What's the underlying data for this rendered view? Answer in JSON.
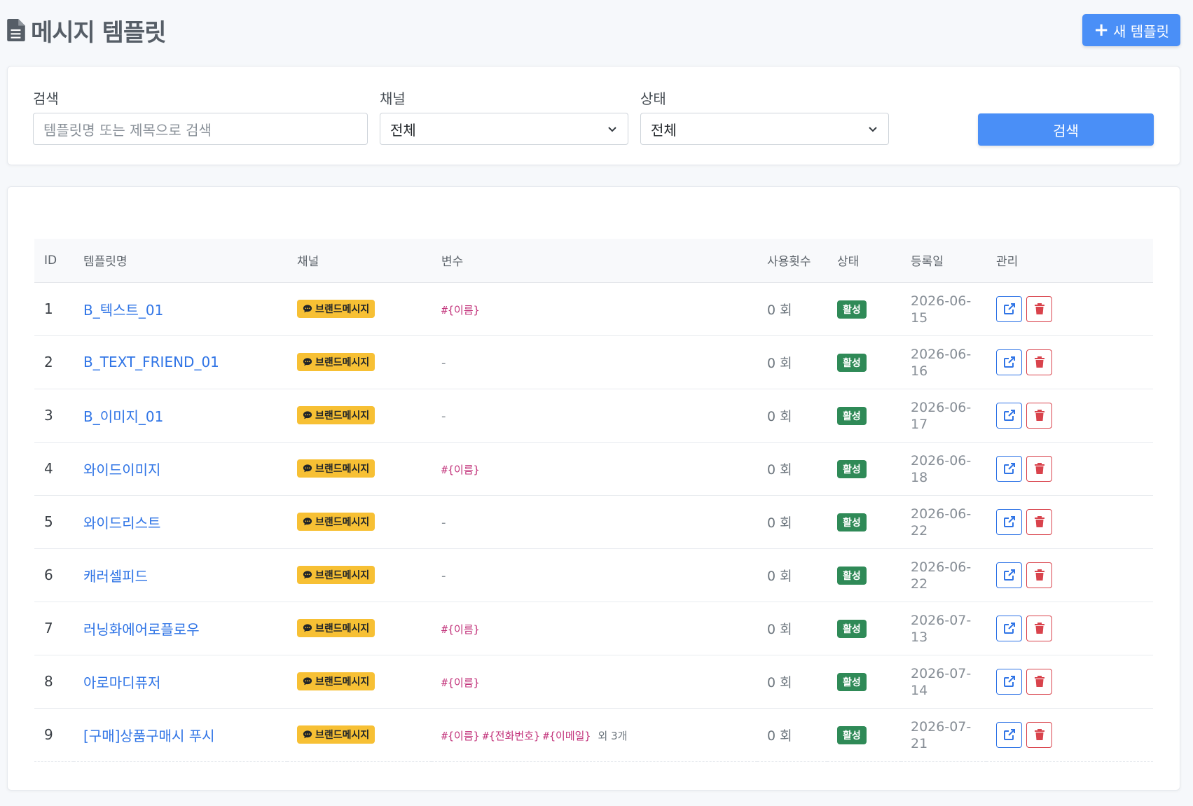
{
  "header": {
    "title": "메시지 템플릿",
    "new_button": "새 템플릿"
  },
  "search": {
    "search_label": "검색",
    "search_placeholder": "템플릿명 또는 제목으로 검색",
    "channel_label": "채널",
    "channel_value": "전체",
    "status_label": "상태",
    "status_value": "전체",
    "search_button": "검색"
  },
  "table": {
    "columns": [
      "ID",
      "템플릿명",
      "채널",
      "변수",
      "사용횟수",
      "상태",
      "등록일",
      "관리"
    ],
    "rows": [
      {
        "id": "1",
        "name": "B_텍스트_01",
        "channel": "브랜드메시지",
        "vars": [
          "#{이름}"
        ],
        "more": "",
        "usage": "0 회",
        "status": "활성",
        "date": "2026-06-15"
      },
      {
        "id": "2",
        "name": "B_TEXT_FRIEND_01",
        "channel": "브랜드메시지",
        "vars": [],
        "more": "",
        "usage": "0 회",
        "status": "활성",
        "date": "2026-06-16"
      },
      {
        "id": "3",
        "name": "B_이미지_01",
        "channel": "브랜드메시지",
        "vars": [],
        "more": "",
        "usage": "0 회",
        "status": "활성",
        "date": "2026-06-17"
      },
      {
        "id": "4",
        "name": "와이드이미지",
        "channel": "브랜드메시지",
        "vars": [
          "#{이름}"
        ],
        "more": "",
        "usage": "0 회",
        "status": "활성",
        "date": "2026-06-18"
      },
      {
        "id": "5",
        "name": "와이드리스트",
        "channel": "브랜드메시지",
        "vars": [],
        "more": "",
        "usage": "0 회",
        "status": "활성",
        "date": "2026-06-22"
      },
      {
        "id": "6",
        "name": "캐러셀피드",
        "channel": "브랜드메시지",
        "vars": [],
        "more": "",
        "usage": "0 회",
        "status": "활성",
        "date": "2026-06-22"
      },
      {
        "id": "7",
        "name": "러닝화에어로플로우",
        "channel": "브랜드메시지",
        "vars": [
          "#{이름}"
        ],
        "more": "",
        "usage": "0 회",
        "status": "활성",
        "date": "2026-07-13"
      },
      {
        "id": "8",
        "name": "아로마디퓨저",
        "channel": "브랜드메시지",
        "vars": [
          "#{이름}"
        ],
        "more": "",
        "usage": "0 회",
        "status": "활성",
        "date": "2026-07-14"
      },
      {
        "id": "9",
        "name": "[구매]상품구매시 푸시",
        "channel": "브랜드메시지",
        "vars": [
          "#{이름}",
          "#{전화번호}",
          "#{이메일}"
        ],
        "more": "외 3개",
        "usage": "0 회",
        "status": "활성",
        "date": "2026-07-21"
      }
    ],
    "empty_vars": "-"
  },
  "colors": {
    "primary": "#4a8ff7",
    "link": "#2f74e6",
    "channel_badge": "#f7c034",
    "status_badge": "#2f8a57",
    "variable": "#c2327a",
    "delete": "#d9434c"
  },
  "icons": {
    "title": "file-text-icon",
    "new": "plus-icon",
    "dropdown": "chevron-down-icon",
    "channel": "chat-bubble-icon",
    "edit": "external-link-icon",
    "delete": "trash-icon"
  }
}
